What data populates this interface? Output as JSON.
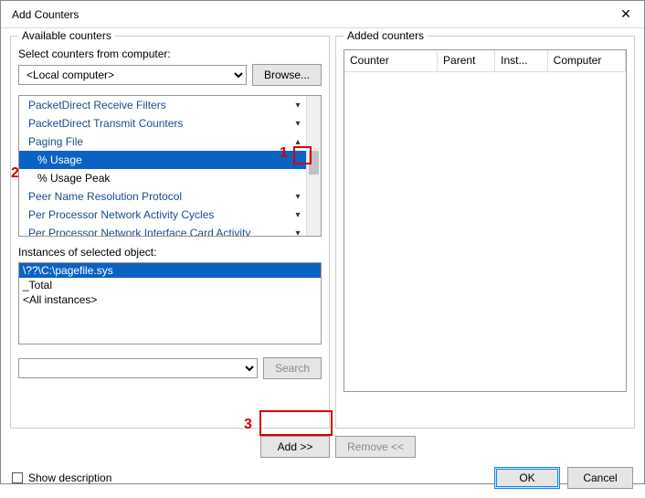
{
  "window": {
    "title": "Add Counters"
  },
  "left": {
    "group_title": "Available counters",
    "select_from_label": "Select counters from computer:",
    "computer": "<Local computer>",
    "browse": "Browse...",
    "counters": [
      {
        "name": "PacketDirect Receive Filters",
        "chev": "down",
        "kind": "group"
      },
      {
        "name": "PacketDirect Transmit Counters",
        "chev": "down",
        "kind": "group"
      },
      {
        "name": "Paging File",
        "chev": "up",
        "kind": "group"
      },
      {
        "name": "% Usage",
        "chev": "",
        "kind": "child",
        "selected": true
      },
      {
        "name": "% Usage Peak",
        "chev": "",
        "kind": "child"
      },
      {
        "name": "Peer Name Resolution Protocol",
        "chev": "down",
        "kind": "group"
      },
      {
        "name": "Per Processor Network Activity Cycles",
        "chev": "down",
        "kind": "group"
      },
      {
        "name": "Per Processor Network Interface Card Activity",
        "chev": "down",
        "kind": "group"
      }
    ],
    "instances_label": "Instances of selected object:",
    "instances": [
      {
        "name": "\\??\\C:\\pagefile.sys",
        "selected": true
      },
      {
        "name": "_Total",
        "selected": false
      },
      {
        "name": "<All instances>",
        "selected": false
      }
    ],
    "search_value": "",
    "search_btn": "Search",
    "add_btn": "Add >>"
  },
  "right": {
    "group_title": "Added counters",
    "cols": {
      "counter": "Counter",
      "parent": "Parent",
      "inst": "Inst...",
      "comp": "Computer"
    },
    "remove_btn": "Remove <<"
  },
  "bottom": {
    "show_desc": "Show description",
    "ok": "OK",
    "cancel": "Cancel"
  },
  "callouts": {
    "one": "1",
    "two": "2",
    "three": "3"
  }
}
